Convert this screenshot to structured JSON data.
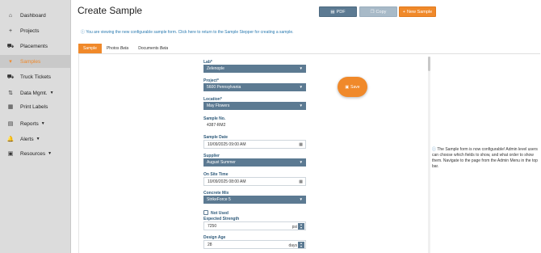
{
  "sidebar": {
    "items": [
      {
        "label": "Dashboard",
        "icon": "⌂",
        "caret": ""
      },
      {
        "label": "Projects",
        "icon": "+",
        "caret": ""
      },
      {
        "label": "Placements",
        "icon": "⛟",
        "caret": ""
      },
      {
        "label": "Samples",
        "icon": "▾",
        "caret": ""
      },
      {
        "label": "Truck Tickets",
        "icon": "⛟",
        "caret": ""
      },
      {
        "label": "Data Mgmt.",
        "icon": "⇅",
        "caret": "▼"
      },
      {
        "label": "Print Labels",
        "icon": "▦",
        "caret": ""
      },
      {
        "label": "Reports",
        "icon": "▤",
        "caret": "▼"
      },
      {
        "label": "Alerts",
        "icon": "🔔",
        "caret": "▼"
      },
      {
        "label": "Resources",
        "icon": "▣",
        "caret": "▼"
      }
    ]
  },
  "header": {
    "title": "Create Sample",
    "pdf_label": "PDF",
    "copy_label": "Copy",
    "new_label": "New Sample",
    "info": "You are viewing the new configurable sample form. Click here to return to the Sample Stepper for creating a sample."
  },
  "tabs": [
    {
      "label": "Sample",
      "beta": ""
    },
    {
      "label": "Photos",
      "beta": "Beta"
    },
    {
      "label": "Documents",
      "beta": "Beta"
    }
  ],
  "form": {
    "lab_label": "Lab*",
    "lab_value": "Zelenople",
    "project_label": "Project*",
    "project_value": "5600 Pennsylvania",
    "location_label": "Location*",
    "location_value": "May Flowers",
    "sample_no_label": "Sample No.",
    "sample_no_value": "4387-RM2",
    "sample_date_label": "Sample Date",
    "sample_date_value": "10/09/2025 09:00 AM",
    "supplier_label": "Supplier",
    "supplier_value": "August Summer",
    "on_site_label": "On Site Time",
    "on_site_value": "10/09/2025 08:00 AM",
    "concrete_mix_label": "Concrete Mix",
    "concrete_mix_value": "StrikeForce 5",
    "not_used_label": "Not Used",
    "expected_strength_label": "Expected Strength",
    "expected_strength_value": "7250",
    "expected_strength_unit": "psi",
    "design_age_label": "Design Age",
    "design_age_value": "28",
    "design_age_unit": "days",
    "save_label": "Save"
  },
  "side_info": "The Sample form is now configurable! Admin level users can choose which fields to show, and what order to show them. Navigate to the page from the Admin Menu in the top bar.",
  "colors": {
    "accent": "#f0892a",
    "primary": "#5c7a92",
    "link": "#2a7ab0"
  }
}
